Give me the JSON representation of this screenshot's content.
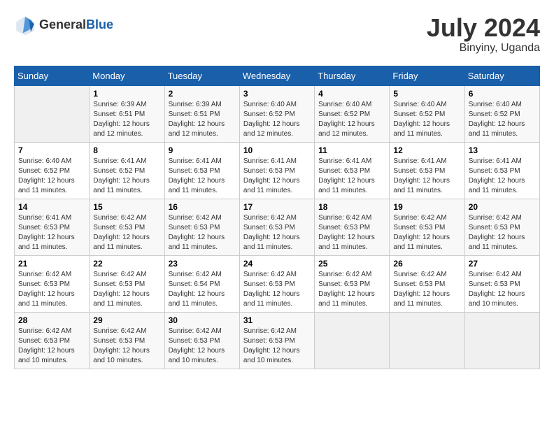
{
  "header": {
    "logo": {
      "general": "General",
      "blue": "Blue"
    },
    "title": "July 2024",
    "location": "Binyiny, Uganda"
  },
  "days_of_week": [
    "Sunday",
    "Monday",
    "Tuesday",
    "Wednesday",
    "Thursday",
    "Friday",
    "Saturday"
  ],
  "weeks": [
    [
      {
        "day": "",
        "sunrise": "",
        "sunset": "",
        "daylight": ""
      },
      {
        "day": "1",
        "sunrise": "Sunrise: 6:39 AM",
        "sunset": "Sunset: 6:51 PM",
        "daylight": "Daylight: 12 hours and 12 minutes."
      },
      {
        "day": "2",
        "sunrise": "Sunrise: 6:39 AM",
        "sunset": "Sunset: 6:51 PM",
        "daylight": "Daylight: 12 hours and 12 minutes."
      },
      {
        "day": "3",
        "sunrise": "Sunrise: 6:40 AM",
        "sunset": "Sunset: 6:52 PM",
        "daylight": "Daylight: 12 hours and 12 minutes."
      },
      {
        "day": "4",
        "sunrise": "Sunrise: 6:40 AM",
        "sunset": "Sunset: 6:52 PM",
        "daylight": "Daylight: 12 hours and 12 minutes."
      },
      {
        "day": "5",
        "sunrise": "Sunrise: 6:40 AM",
        "sunset": "Sunset: 6:52 PM",
        "daylight": "Daylight: 12 hours and 11 minutes."
      },
      {
        "day": "6",
        "sunrise": "Sunrise: 6:40 AM",
        "sunset": "Sunset: 6:52 PM",
        "daylight": "Daylight: 12 hours and 11 minutes."
      }
    ],
    [
      {
        "day": "7",
        "sunrise": "Sunrise: 6:40 AM",
        "sunset": "Sunset: 6:52 PM",
        "daylight": "Daylight: 12 hours and 11 minutes."
      },
      {
        "day": "8",
        "sunrise": "Sunrise: 6:41 AM",
        "sunset": "Sunset: 6:52 PM",
        "daylight": "Daylight: 12 hours and 11 minutes."
      },
      {
        "day": "9",
        "sunrise": "Sunrise: 6:41 AM",
        "sunset": "Sunset: 6:53 PM",
        "daylight": "Daylight: 12 hours and 11 minutes."
      },
      {
        "day": "10",
        "sunrise": "Sunrise: 6:41 AM",
        "sunset": "Sunset: 6:53 PM",
        "daylight": "Daylight: 12 hours and 11 minutes."
      },
      {
        "day": "11",
        "sunrise": "Sunrise: 6:41 AM",
        "sunset": "Sunset: 6:53 PM",
        "daylight": "Daylight: 12 hours and 11 minutes."
      },
      {
        "day": "12",
        "sunrise": "Sunrise: 6:41 AM",
        "sunset": "Sunset: 6:53 PM",
        "daylight": "Daylight: 12 hours and 11 minutes."
      },
      {
        "day": "13",
        "sunrise": "Sunrise: 6:41 AM",
        "sunset": "Sunset: 6:53 PM",
        "daylight": "Daylight: 12 hours and 11 minutes."
      }
    ],
    [
      {
        "day": "14",
        "sunrise": "Sunrise: 6:41 AM",
        "sunset": "Sunset: 6:53 PM",
        "daylight": "Daylight: 12 hours and 11 minutes."
      },
      {
        "day": "15",
        "sunrise": "Sunrise: 6:42 AM",
        "sunset": "Sunset: 6:53 PM",
        "daylight": "Daylight: 12 hours and 11 minutes."
      },
      {
        "day": "16",
        "sunrise": "Sunrise: 6:42 AM",
        "sunset": "Sunset: 6:53 PM",
        "daylight": "Daylight: 12 hours and 11 minutes."
      },
      {
        "day": "17",
        "sunrise": "Sunrise: 6:42 AM",
        "sunset": "Sunset: 6:53 PM",
        "daylight": "Daylight: 12 hours and 11 minutes."
      },
      {
        "day": "18",
        "sunrise": "Sunrise: 6:42 AM",
        "sunset": "Sunset: 6:53 PM",
        "daylight": "Daylight: 12 hours and 11 minutes."
      },
      {
        "day": "19",
        "sunrise": "Sunrise: 6:42 AM",
        "sunset": "Sunset: 6:53 PM",
        "daylight": "Daylight: 12 hours and 11 minutes."
      },
      {
        "day": "20",
        "sunrise": "Sunrise: 6:42 AM",
        "sunset": "Sunset: 6:53 PM",
        "daylight": "Daylight: 12 hours and 11 minutes."
      }
    ],
    [
      {
        "day": "21",
        "sunrise": "Sunrise: 6:42 AM",
        "sunset": "Sunset: 6:53 PM",
        "daylight": "Daylight: 12 hours and 11 minutes."
      },
      {
        "day": "22",
        "sunrise": "Sunrise: 6:42 AM",
        "sunset": "Sunset: 6:53 PM",
        "daylight": "Daylight: 12 hours and 11 minutes."
      },
      {
        "day": "23",
        "sunrise": "Sunrise: 6:42 AM",
        "sunset": "Sunset: 6:54 PM",
        "daylight": "Daylight: 12 hours and 11 minutes."
      },
      {
        "day": "24",
        "sunrise": "Sunrise: 6:42 AM",
        "sunset": "Sunset: 6:53 PM",
        "daylight": "Daylight: 12 hours and 11 minutes."
      },
      {
        "day": "25",
        "sunrise": "Sunrise: 6:42 AM",
        "sunset": "Sunset: 6:53 PM",
        "daylight": "Daylight: 12 hours and 11 minutes."
      },
      {
        "day": "26",
        "sunrise": "Sunrise: 6:42 AM",
        "sunset": "Sunset: 6:53 PM",
        "daylight": "Daylight: 12 hours and 11 minutes."
      },
      {
        "day": "27",
        "sunrise": "Sunrise: 6:42 AM",
        "sunset": "Sunset: 6:53 PM",
        "daylight": "Daylight: 12 hours and 10 minutes."
      }
    ],
    [
      {
        "day": "28",
        "sunrise": "Sunrise: 6:42 AM",
        "sunset": "Sunset: 6:53 PM",
        "daylight": "Daylight: 12 hours and 10 minutes."
      },
      {
        "day": "29",
        "sunrise": "Sunrise: 6:42 AM",
        "sunset": "Sunset: 6:53 PM",
        "daylight": "Daylight: 12 hours and 10 minutes."
      },
      {
        "day": "30",
        "sunrise": "Sunrise: 6:42 AM",
        "sunset": "Sunset: 6:53 PM",
        "daylight": "Daylight: 12 hours and 10 minutes."
      },
      {
        "day": "31",
        "sunrise": "Sunrise: 6:42 AM",
        "sunset": "Sunset: 6:53 PM",
        "daylight": "Daylight: 12 hours and 10 minutes."
      },
      {
        "day": "",
        "sunrise": "",
        "sunset": "",
        "daylight": ""
      },
      {
        "day": "",
        "sunrise": "",
        "sunset": "",
        "daylight": ""
      },
      {
        "day": "",
        "sunrise": "",
        "sunset": "",
        "daylight": ""
      }
    ]
  ]
}
